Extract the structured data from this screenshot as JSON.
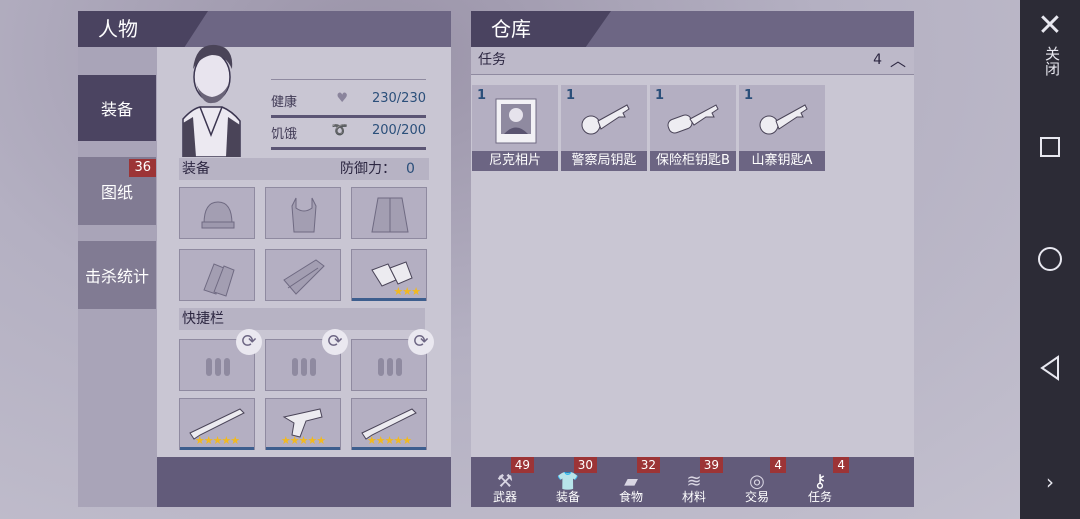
{
  "character_panel": {
    "title": "人物",
    "tabs": [
      {
        "label": "装备",
        "badge": ""
      },
      {
        "label": "图纸",
        "badge": "36"
      },
      {
        "label": "击杀统计",
        "badge": ""
      }
    ],
    "stats": [
      {
        "label": "健康",
        "value": "230/230",
        "icon": "heart-icon"
      },
      {
        "label": "饥饿",
        "value": "200/200",
        "icon": "stomach-icon"
      }
    ],
    "equipment_label": "装备",
    "defense_label": "防御力：",
    "defense_value": "0",
    "equipment_slots": [
      {
        "icon": "beanie-hat-icon"
      },
      {
        "icon": "tank-top-icon"
      },
      {
        "icon": "jacket-icon"
      },
      {
        "icon": "gloves-icon"
      },
      {
        "icon": "pants-icon"
      },
      {
        "icon": "sneakers-icon",
        "stars": "★★★"
      }
    ],
    "quickbar_label": "快捷栏",
    "ammo_slots": [
      {
        "icon": "ammo-icon"
      },
      {
        "icon": "ammo-icon"
      },
      {
        "icon": "ammo-icon"
      }
    ],
    "weapon_slots": [
      {
        "icon": "shotgun-icon",
        "stars": "★★★★★"
      },
      {
        "icon": "revolver-icon",
        "stars": "★★★★★"
      },
      {
        "icon": "shotgun-icon",
        "stars": "★★★★★"
      }
    ]
  },
  "warehouse": {
    "title": "仓库",
    "category_label": "任务",
    "category_count": "4",
    "items": [
      {
        "qty": "1",
        "name": "尼克相片",
        "icon": "photo-icon"
      },
      {
        "qty": "1",
        "name": "警察局钥匙",
        "icon": "key-icon"
      },
      {
        "qty": "1",
        "name": "保险柜钥匙B",
        "icon": "key-icon"
      },
      {
        "qty": "1",
        "name": "山寨钥匙A",
        "icon": "key-icon"
      }
    ],
    "categories": [
      {
        "label": "武器",
        "count": "49",
        "icon": "axe-icon"
      },
      {
        "label": "装备",
        "count": "30",
        "icon": "shirt-icon"
      },
      {
        "label": "食物",
        "count": "32",
        "icon": "bread-icon"
      },
      {
        "label": "材料",
        "count": "39",
        "icon": "wood-icon"
      },
      {
        "label": "交易",
        "count": "4",
        "icon": "coin-icon"
      },
      {
        "label": "任务",
        "count": "4",
        "icon": "key-icon"
      }
    ]
  },
  "navbar": {
    "close_label": "关闭"
  },
  "colors": {
    "header_dark": "#4a4360",
    "badge_red": "#9c3436",
    "star_gold": "#f1b91f",
    "qty_blue": "#2b4f7a"
  }
}
